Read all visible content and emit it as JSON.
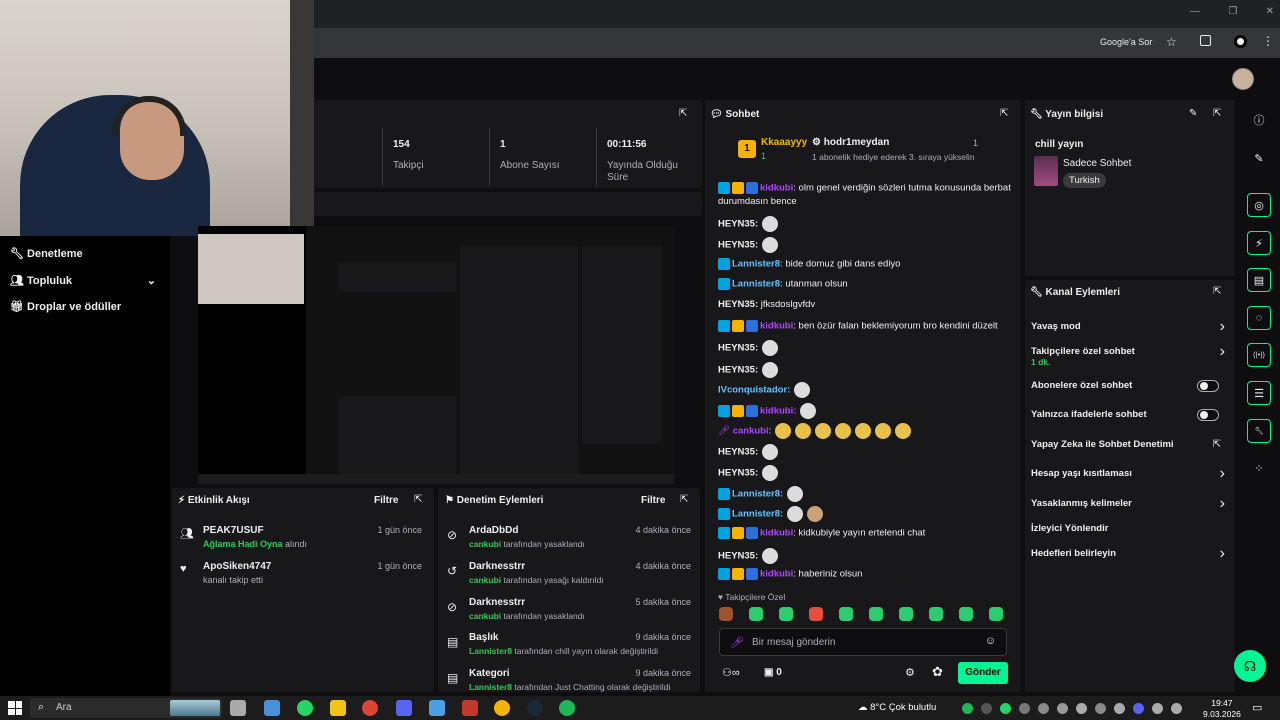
{
  "browser": {
    "search_pill": "Google'a Sor"
  },
  "left_menu": [
    {
      "label": "Denetleme"
    },
    {
      "label": "Topluluk"
    },
    {
      "label": "Droplar ve ödüller"
    }
  ],
  "stats": [
    {
      "value": "154",
      "label": "Takipçi"
    },
    {
      "value": "1",
      "label": "Abone Sayısı"
    },
    {
      "value": "00:11:56",
      "label": "Yayında Olduğu Süre"
    }
  ],
  "chat": {
    "title": "Sohbet",
    "top_user": "Kkaaayyy",
    "top_rank": "1",
    "top_count": "1",
    "gifter": "hodr1meydan",
    "gifter_count": "1",
    "gifter_msg": "1 abonelik hediye ederek 3. sıraya yükselin",
    "messages": [
      {
        "user": "kidkubi",
        "text": ": olm genel verdiğin sözleri tutma konusunda berbat"
      },
      {
        "user": "",
        "text": "durumdasın bence"
      },
      {
        "user": "HEYN35:",
        "text": ""
      },
      {
        "user": "HEYN35:",
        "text": ""
      },
      {
        "user": "Lannister8",
        "text": ": bide domuz gibi dans ediyo"
      },
      {
        "user": "Lannister8",
        "text": ": utanman olsun"
      },
      {
        "user": "HEYN35:",
        "text": " jfksdoslgvfdv"
      },
      {
        "user": "kidkubi",
        "text": ": ben özür falan beklemiyorum bro kendini düzelt"
      },
      {
        "user": "HEYN35:",
        "text": ""
      },
      {
        "user": "HEYN35:",
        "text": ""
      },
      {
        "user": "IVconquistador:",
        "text": ""
      },
      {
        "user": "kidkubi:",
        "text": ""
      },
      {
        "user": "cankubi",
        "text": ":"
      },
      {
        "user": "HEYN35:",
        "text": ""
      },
      {
        "user": "HEYN35:",
        "text": ""
      },
      {
        "user": "Lannister8:",
        "text": ""
      },
      {
        "user": "Lannister8:",
        "text": ""
      },
      {
        "user": "kidkubi",
        "text": ": kidkubiyle yayın ertelendi chat"
      },
      {
        "user": "HEYN35:",
        "text": ""
      },
      {
        "user": "kidkubi",
        "text": ": haberiniz olsun"
      }
    ],
    "followers_only": "Takipçilere Özel",
    "placeholder": "Bir mesaj gönderin",
    "points": "0",
    "send": "Gönder"
  },
  "stream_info": {
    "title": "Yayın bilgisi",
    "stream_title": "chill yayın",
    "category": "Sadece Sohbet",
    "tag": "Turkish"
  },
  "channel_actions": {
    "title": "Kanal Eylemleri",
    "items": [
      {
        "label": "Yavaş mod",
        "sub": ""
      },
      {
        "label": "Takipçilere özel sohbet",
        "sub": "1 dk."
      },
      {
        "label": "Abonelere özel sohbet",
        "sub": ""
      },
      {
        "label": "Yalnızca ifadelerle sohbet",
        "sub": ""
      },
      {
        "label": "Yapay Zeka ile Sohbet Denetimi",
        "sub": ""
      },
      {
        "label": "Hesap yaşı kısıtlaması",
        "sub": ""
      },
      {
        "label": "Yasaklanmış kelimeler",
        "sub": ""
      },
      {
        "label": "İzleyici Yönlendir",
        "sub": ""
      },
      {
        "label": "Hedefleri belirleyin",
        "sub": ""
      }
    ]
  },
  "activity": {
    "title": "Etkinlik Akışı",
    "filter": "Filtre",
    "items": [
      {
        "user": "PEAK7USUF",
        "time": "1 gün önce",
        "detail_green": "Ağlama Hadi Oyna",
        "detail": " alındı"
      },
      {
        "user": "ApoSiken4747",
        "time": "1 gün önce",
        "detail_green": "",
        "detail": "kanalı takip etti"
      }
    ]
  },
  "mod_actions": {
    "title": "Denetim Eylemleri",
    "filter": "Filtre",
    "items": [
      {
        "user": "ArdaDbDd",
        "time": "4 dakika önce",
        "by": "cankubi",
        "detail": " tarafından yasaklandı"
      },
      {
        "user": "Darknesstrr",
        "time": "4 dakika önce",
        "by": "cankubi",
        "detail": " tarafından yasağı kaldırıldı"
      },
      {
        "user": "Darknesstrr",
        "time": "5 dakika önce",
        "by": "cankubi",
        "detail": " tarafından yasaklandı"
      },
      {
        "user": "Başlık",
        "time": "9 dakika önce",
        "by": "Lannister8",
        "detail": " tarafından chill yayın olarak değiştirildi"
      },
      {
        "user": "Kategori",
        "time": "9 dakika önce",
        "by": "Lannister8",
        "detail": " tarafından Just Chatting olarak değiştirildi"
      }
    ]
  },
  "taskbar": {
    "search": "Ara",
    "weather": "8°C  Çok bulutlu",
    "time": "19:47",
    "date": "9.03.2026"
  }
}
